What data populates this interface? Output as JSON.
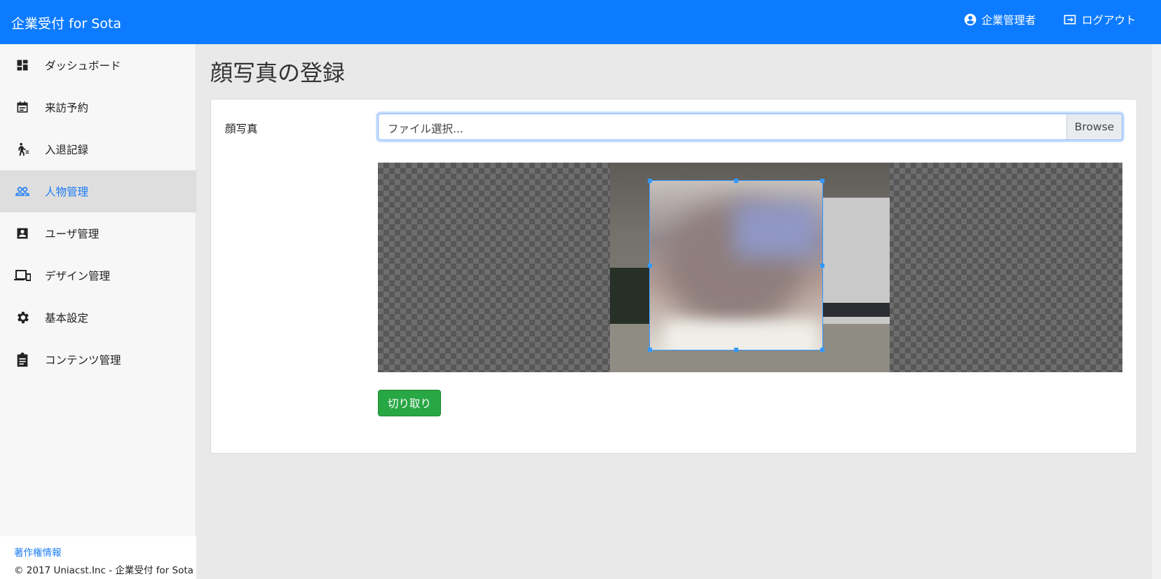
{
  "app": {
    "title": "企業受付 for Sota",
    "user_label": "企業管理者",
    "logout_label": "ログアウト"
  },
  "sidebar": {
    "items": [
      {
        "label": "ダッシュボード",
        "icon": "dashboard-icon"
      },
      {
        "label": "来訪予約",
        "icon": "calendar-icon"
      },
      {
        "label": "入退記録",
        "icon": "walking-person-icon"
      },
      {
        "label": "人物管理",
        "icon": "people-icon",
        "active": true
      },
      {
        "label": "ユーザ管理",
        "icon": "account-box-icon"
      },
      {
        "label": "デザイン管理",
        "icon": "devices-icon"
      },
      {
        "label": "基本設定",
        "icon": "gear-icon"
      },
      {
        "label": "コンテンツ管理",
        "icon": "clipboard-icon"
      }
    ],
    "footer": {
      "link": "著作権情報",
      "copyright": "© 2017 Uniacst.Inc - 企業受付 for Sota"
    }
  },
  "main": {
    "title": "顔写真の登録",
    "field_label": "顔写真",
    "file_placeholder": "ファイル選択...",
    "browse_label": "Browse",
    "crop_button": "切り取り"
  },
  "colors": {
    "accent": "#0d7bff",
    "active_text": "#1a7cf5",
    "crop_button": "#28a745"
  }
}
